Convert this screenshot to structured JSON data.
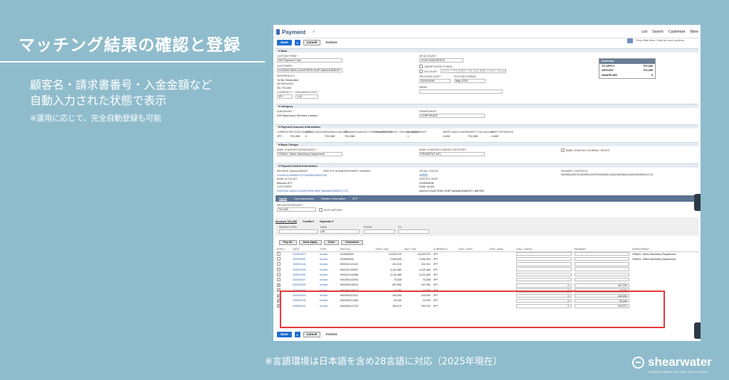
{
  "slide": {
    "heading": "マッチング結果の確認と登録",
    "desc1": "顧客名・請求書番号・入金金額など",
    "desc2": "自動入力された状態で表示",
    "note": "※運用に応じて、完全自動登録も可能",
    "footer": "※言語環境は日本語を含め28言語に対応（2025年現在）",
    "brand": "shearwater",
    "brand_sub": "TRANSFORMATIVE ERP SOLUTIONS"
  },
  "app": {
    "title": "Payment",
    "toplinks": [
      "List",
      "Search",
      "Customize",
      "More"
    ],
    "hint": "Drop files here. Click for more options.",
    "save": "Save",
    "cancel": "Cancel",
    "actions": "Actions"
  },
  "main": {
    "section": "Main",
    "custom_form_lbl": "Custom Form *",
    "custom_form": "333 Payment Form",
    "customer_lbl": "Customer *",
    "customer": "D100000 ANGLO-EASTERN SHIP MANAGEMENT",
    "ref_lbl": "Reference #",
    "ref": "To Be Generated",
    "ar_lbl": "A/R Balance",
    "ar": "26,770,000",
    "currency_lbl": "Currency *",
    "currency": "JPY",
    "exrate_lbl": "Exchange Rate *",
    "exrate": "1.00",
    "account_lbl": "AR Account",
    "account": "12110 A/R(CREDIT)",
    "undep_lbl": "Undeposited Funds",
    "acct_lbl": "Account",
    "acct": "10120 三井住友銀行 大阪 支店 普通 1234567 Mitsubishi",
    "date_lbl": "Received Date *",
    "date": "2025/05/08",
    "period_lbl": "Posting Period",
    "period": "May 2025",
    "memo_lbl": "Memo",
    "summary_title": "Summary",
    "summary": [
      {
        "k": "TO APPLY",
        "v": "702,280"
      },
      {
        "k": "APPLIED",
        "v": "702,280"
      },
      {
        "k": "UNAPPLIED",
        "v": "0"
      }
    ]
  },
  "category": {
    "section": "Category",
    "sub_lbl": "Subsidiary",
    "sub": "333 Machinery Services Limited",
    "dept_lbl": "Department",
    "dept": "CORPORATE"
  },
  "amount": {
    "section": "Payment Amount Information",
    "labels": [
      "Currency",
      "Received Amount",
      "Applied Amount",
      "Remaining Amount",
      "Remaining Amount Foreign Currency",
      "Original Currency Original Amount",
      "Exchange Rate",
      "Import Bank Charge",
      "Tariff Total Amount",
      "Tariff Difference"
    ],
    "values": [
      "JPY",
      "702,280",
      "0",
      "702,280",
      "702,280",
      "",
      "1",
      "3,450",
      "702,280",
      "-3,450"
    ]
  },
  "bank": {
    "section": "Bank Charge",
    "dept_lbl": "Bank Charges Department *",
    "dept": "OSAKA : Marin Machinery Department",
    "cat_lbl": "Bank Charges Charge Category",
    "cat": "PROMPT(P-3/F)",
    "journal": "Bank Charges Journal Create"
  },
  "detail": {
    "section": "Payment Detail Information",
    "pm_lbl": "Payment Management",
    "pm": "D1000701000001 ETSU000000000700",
    "dm_lbl": "Deposit Number/Payment Number",
    "dm": "",
    "status_lbl": "Detail Status",
    "status": "未適用",
    "ba_lbl": "Bank Account",
    "ba": "Mizuho-JPY",
    "dd_lbl": "Deposit Date",
    "dd": "2025/05/08",
    "cust_lbl": "Customer",
    "cust": "D100000 ANGLO-EASTERN SHIP MANAGEMENT LTD.",
    "bn_lbl": "Bank Name",
    "bn": "ANGLO-EASTERN SHIP MANAGEMENT LIMITED",
    "inv_lbl": "Payment Contents",
    "inv": "INV2504-00070,INV2504-00070,INV2504-01115,INV2504-01453,INV2504-01713"
  },
  "apply": {
    "tabs": [
      "Apply",
      "Communication",
      "System Information",
      "EFT"
    ],
    "recv_lbl": "Received Amount *",
    "recv": "702,280",
    "auto": "Auto Applied",
    "ptabs": [
      "Invoices 702,280",
      "Credits 0",
      "Deposits 0"
    ],
    "search_lbl": "Search Item",
    "date_lbl": "Date",
    "date": "All",
    "from_lbl": "From",
    "to_lbl": "To",
    "buttons": [
      "Pay All",
      "Auto Apply",
      "Clear",
      "Customize"
    ],
    "columns": [
      "Apply",
      "Date",
      "Type",
      "Ref No.",
      "Orig. Amt.",
      "Amt. Due",
      "Currency",
      "Disc. Date",
      "Disc. Avail.",
      "Disc. Taken",
      "Payment",
      "Department"
    ],
    "rows": [
      {
        "c": false,
        "date": "2025/04/01",
        "type": "Invoice",
        "ref": "D10000000",
        "orig": "24,003,070",
        "due": "24,003,070",
        "cur": "JPY",
        "disc": "",
        "pay": "",
        "dept": "OSAKA : Marin Machinery Department"
      },
      {
        "c": false,
        "date": "2025/06/30",
        "type": "Invoice",
        "ref": "D10000004",
        "orig": "2,054,000",
        "due": "2,054,000",
        "cur": "JPY",
        "disc": "",
        "pay": "",
        "dept": "OSAKA : Marin Machinery Department"
      },
      {
        "c": false,
        "date": "2025/01/15",
        "type": "Invoice",
        "ref": "INV2411-01413",
        "orig": "101,010",
        "due": "101,010",
        "cur": "JPY",
        "disc": "",
        "pay": "",
        "dept": ""
      },
      {
        "c": false,
        "date": "2025/12/05",
        "type": "Invoice",
        "ref": "INV2412-02557",
        "orig": "4,141,460",
        "due": "4,141,460",
        "cur": "JPY",
        "disc": "",
        "pay": "",
        "dept": ""
      },
      {
        "c": false,
        "date": "2025/12/05",
        "type": "Invoice",
        "ref": "INV2412-02558",
        "orig": "4,141,460",
        "due": "4,141,460",
        "cur": "JPY",
        "disc": "",
        "pay": "",
        "dept": ""
      },
      {
        "c": false,
        "date": "2025/02/27",
        "type": "Invoice",
        "ref": "INV2502-02493",
        "orig": "70,035",
        "due": "70,035",
        "cur": "JPY",
        "disc": "",
        "pay": "",
        "dept": ""
      },
      {
        "c": true,
        "date": "2025/04/05",
        "type": "Invoice",
        "ref": "INV2504-00070",
        "orig": "407,000",
        "due": "407,000",
        "cur": "JPY",
        "disc": "0",
        "pay": "407,000",
        "dept": ""
      },
      {
        "c": true,
        "date": "2025/04/05",
        "type": "Invoice",
        "ref": "INV2504-00070",
        "orig": "14,000",
        "due": "14,000",
        "cur": "JPY",
        "disc": "0",
        "pay": "14,000",
        "dept": ""
      },
      {
        "c": true,
        "date": "2025/04/05",
        "type": "Invoice",
        "ref": "INV2504-01115",
        "orig": "100,000",
        "due": "100,000",
        "cur": "JPY",
        "disc": "0",
        "pay": "100,000",
        "dept": ""
      },
      {
        "c": true,
        "date": "2025/04/15",
        "type": "Invoice",
        "ref": "INV2504-01453",
        "orig": "32,000",
        "due": "32,000",
        "cur": "JPY",
        "disc": "0",
        "pay": "32,000",
        "dept": ""
      },
      {
        "c": true,
        "date": "2025/04/15",
        "type": "Invoice",
        "ref": "INV2504-01713",
        "orig": "150,070",
        "due": "150,070",
        "cur": "JPY",
        "disc": "0",
        "pay": "150,070",
        "dept": ""
      }
    ]
  }
}
